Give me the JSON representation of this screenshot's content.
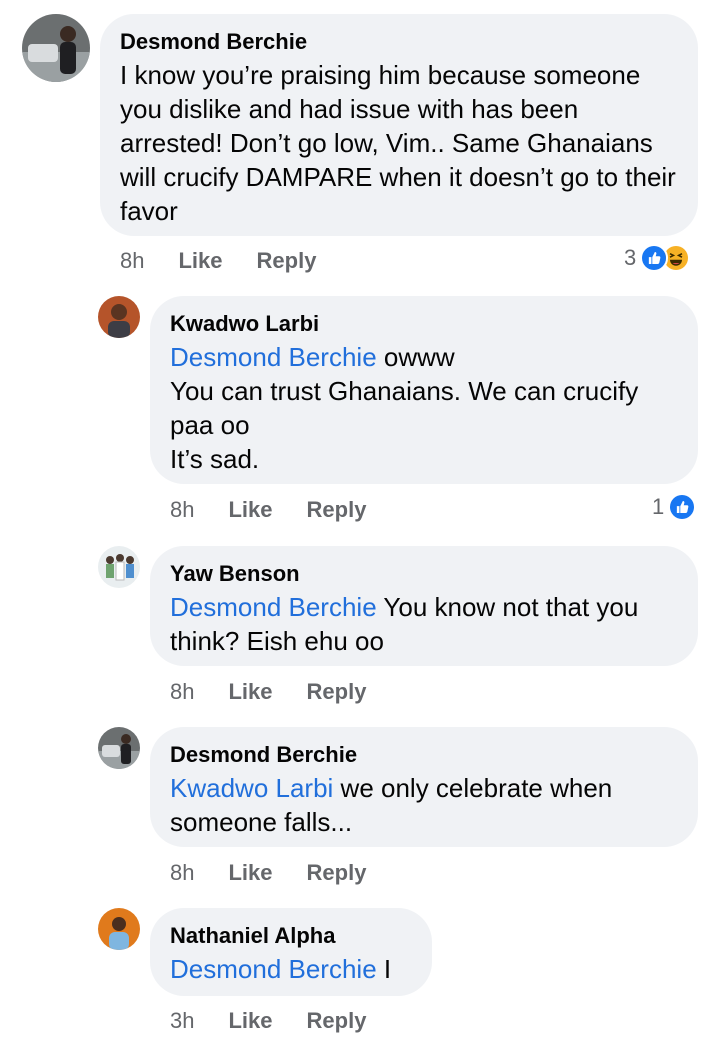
{
  "comments": [
    {
      "author": "Desmond Berchie",
      "mention": "",
      "text": "I know you’re praising him because someone you dislike and had issue with has been arrested! Don’t go low, Vim.. Same Ghanaians will crucify DAMPARE when it doesn’t go to their favor",
      "time": "8h",
      "like": "Like",
      "reply": "Reply",
      "reaction_count": "3",
      "reactions": [
        "like-icon",
        "haha-icon"
      ]
    },
    {
      "author": "Kwadwo Larbi",
      "mention": "Desmond Berchie",
      "text": " owww\nYou can trust Ghanaians. We can crucify paa oo\nIt’s sad.",
      "time": "8h",
      "like": "Like",
      "reply": "Reply",
      "reaction_count": "1",
      "reactions": [
        "like-icon"
      ]
    },
    {
      "author": "Yaw Benson",
      "mention": "Desmond Berchie",
      "text": " You know not that you think? Eish ehu oo",
      "time": "8h",
      "like": "Like",
      "reply": "Reply"
    },
    {
      "author": "Desmond Berchie",
      "mention": "Kwadwo Larbi",
      "text": " we only celebrate when someone falls...",
      "time": "8h",
      "like": "Like",
      "reply": "Reply"
    },
    {
      "author": "Nathaniel Alpha",
      "mention": "Desmond Berchie",
      "text": " I",
      "time": "3h",
      "like": "Like",
      "reply": "Reply"
    }
  ],
  "colors": {
    "bubble": "#f0f2f5",
    "mention": "#216fdb",
    "meta": "#65676b",
    "like_blue": "#1877f2",
    "haha_yellow": "#f7b125"
  }
}
